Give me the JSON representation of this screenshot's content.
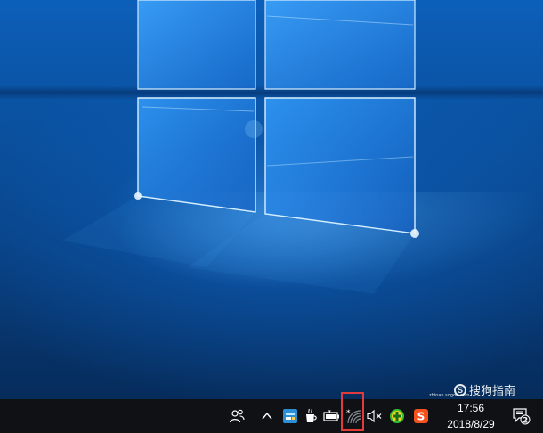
{
  "taskbar": {
    "tray_icons": [
      {
        "name": "people-icon"
      },
      {
        "name": "chevron-up-icon"
      },
      {
        "name": "app-tray-icon"
      },
      {
        "name": "mug-tray-icon"
      },
      {
        "name": "battery-icon"
      },
      {
        "name": "wifi-icon"
      },
      {
        "name": "speaker-muted-icon"
      },
      {
        "name": "green-plus-icon"
      },
      {
        "name": "sogou-input-icon",
        "label": "S"
      }
    ],
    "clock": {
      "time": "17:56",
      "date": "2018/8/29"
    },
    "notification_count": "2"
  },
  "watermark": {
    "text": "搜狗指南",
    "logo_glyph": "S",
    "sub_text": "zhinan.sogou.com"
  },
  "colors": {
    "highlight": "#e23b3b",
    "taskbar": "#0f1115",
    "desktop": "#0a4f9c",
    "sogou_orange": "#f4511e",
    "plus_green": "#35c12d"
  }
}
